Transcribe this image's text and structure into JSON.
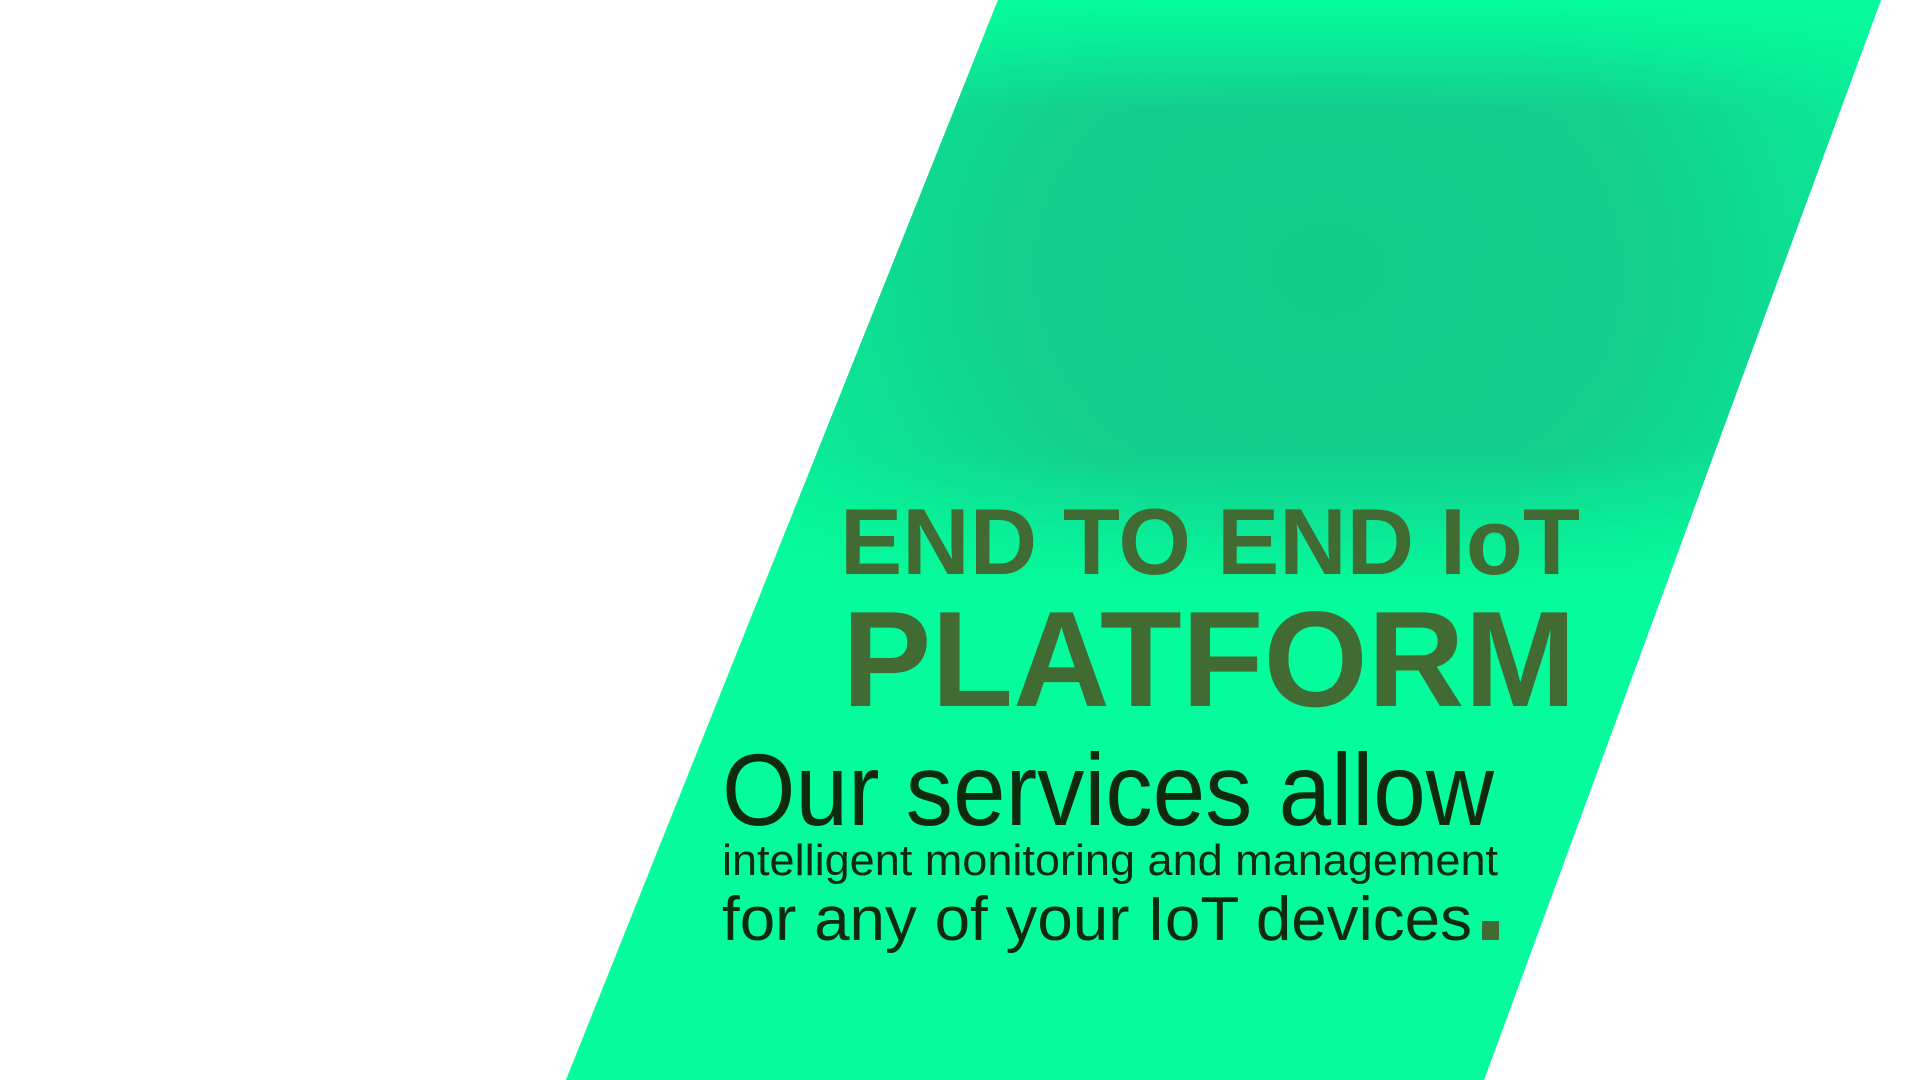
{
  "hero": {
    "title_line1": "END TO END IoT",
    "title_line2": "PLATFORM",
    "tagline_line1": "Our services allow",
    "tagline_line2": "intelligent monitoring and management",
    "tagline_line3": "for any of your IoT devices"
  },
  "colors": {
    "band": "#05FC9C",
    "band_shade": "#12CC8C",
    "title": "#426B34",
    "text": "#0F2A0C",
    "background": "#FFFFFF"
  }
}
